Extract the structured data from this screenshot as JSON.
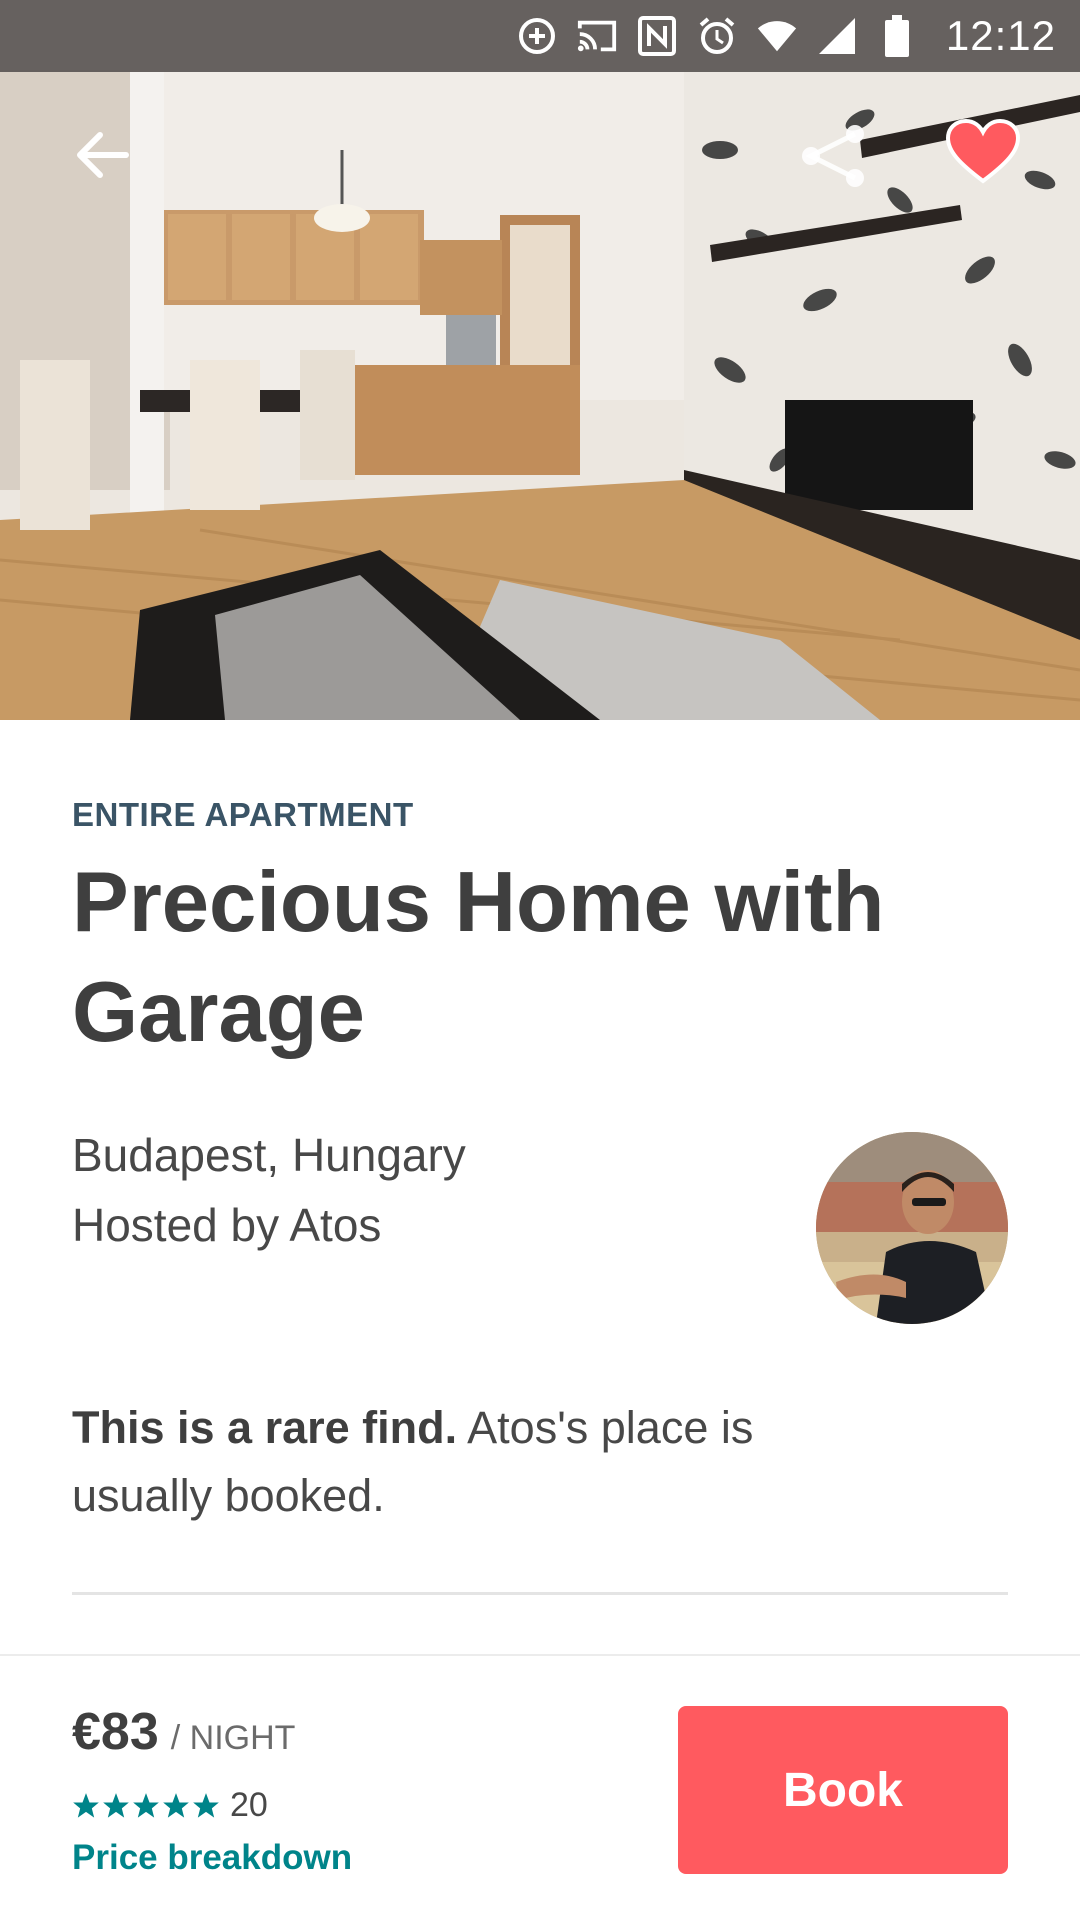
{
  "status_bar": {
    "time": "12:12",
    "icons": [
      "data-saver-icon",
      "cast-icon",
      "nfc-icon",
      "alarm-icon",
      "wifi-icon",
      "signal-icon",
      "battery-icon"
    ]
  },
  "hero": {
    "image": "apartment-living-room-photo",
    "back_icon": "arrow-left-icon",
    "share_icon": "share-icon",
    "favorite_icon": "heart-icon",
    "favorite_color": "#ff5a5f"
  },
  "listing": {
    "room_type": "ENTIRE APARTMENT",
    "title": "Precious Home with Garage",
    "location": "Budapest, Hungary",
    "host_line": "Hosted by Atos",
    "rare_bold": "This is a rare find.",
    "rare_rest": " Atos's place is usually booked."
  },
  "booking": {
    "price": "€83",
    "per": "/ NIGHT",
    "rating_stars": 5,
    "review_count": "20",
    "price_breakdown": "Price breakdown",
    "book_label": "Book",
    "accent": "#ff5a5f",
    "link_color": "#00848a"
  }
}
